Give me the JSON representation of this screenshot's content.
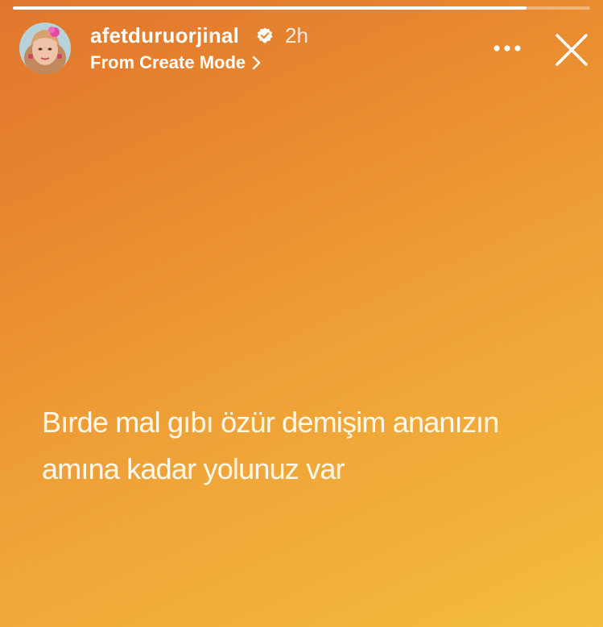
{
  "story": {
    "progress_fraction": 0.89,
    "username": "afetduruorjinal",
    "verified_icon": "verified-badge-icon",
    "time_ago": "2h",
    "source_label": "From Create Mode",
    "source_chevron_icon": "chevron-right-icon",
    "more_icon": "more-options-icon",
    "close_icon": "close-icon",
    "avatar_icon": "profile-avatar",
    "background_colors": [
      "#e0762d",
      "#f4bd3f"
    ],
    "text_lines": [
      "Bırde mal gıbı özür demişim ananızın",
      "amına kadar yolunuz var"
    ]
  }
}
